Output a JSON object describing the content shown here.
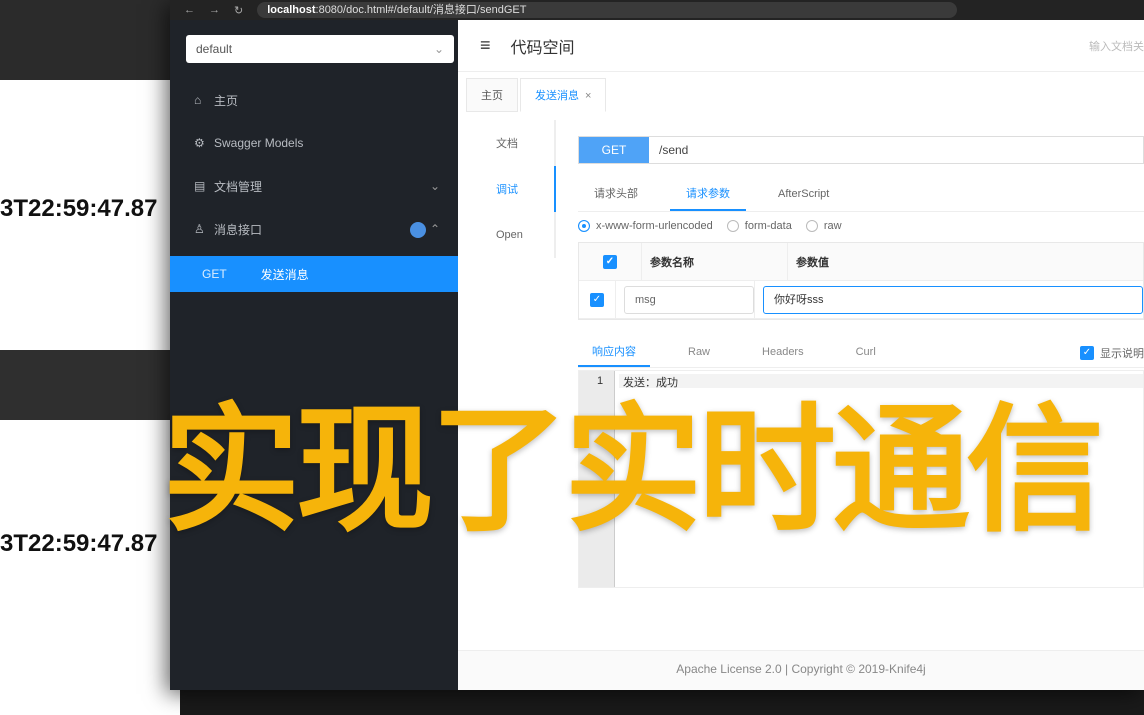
{
  "background": {
    "timestamp_1": "3T22:59:47.87",
    "timestamp_2": "3T22:59:47.87"
  },
  "browser": {
    "url_host": "localhost",
    "url_rest": ":8080/doc.html#/default/消息接口/sendGET"
  },
  "sidebar": {
    "namespace": "default",
    "items": [
      {
        "label": "主页",
        "icon": "home-icon"
      },
      {
        "label": "Swagger Models",
        "icon": "gear-icon"
      },
      {
        "label": "文档管理",
        "icon": "document-icon"
      },
      {
        "label": "消息接口",
        "icon": "group-icon"
      }
    ],
    "active_sub": {
      "method": "GET",
      "label": "发送消息"
    }
  },
  "header": {
    "title": "代码空间",
    "search_placeholder": "输入文档关"
  },
  "tabs": [
    {
      "label": "主页"
    },
    {
      "label": "发送消息"
    }
  ],
  "side_tabs": [
    "文档",
    "调试",
    "Open"
  ],
  "request": {
    "method": "GET",
    "path": "/send"
  },
  "request_tabs": [
    "请求头部",
    "请求参数",
    "AfterScript"
  ],
  "content_types": [
    "x-www-form-urlencoded",
    "form-data",
    "raw"
  ],
  "params": {
    "headers": [
      "参数名称",
      "参数值"
    ],
    "rows": [
      {
        "name": "msg",
        "value": "你好呀sss"
      }
    ]
  },
  "response_tabs": [
    "响应内容",
    "Raw",
    "Headers",
    "Curl"
  ],
  "show_desc": "显示说明",
  "editor": {
    "line": "1",
    "content": "发送：成功"
  },
  "footer": "Apache License 2.0 | Copyright © 2019-Knife4j",
  "overlay_text": "实现了实时通信",
  "colors": {
    "accent": "#1890ff",
    "overlay": "#f6b40a",
    "sidebar": "#1f2329"
  }
}
